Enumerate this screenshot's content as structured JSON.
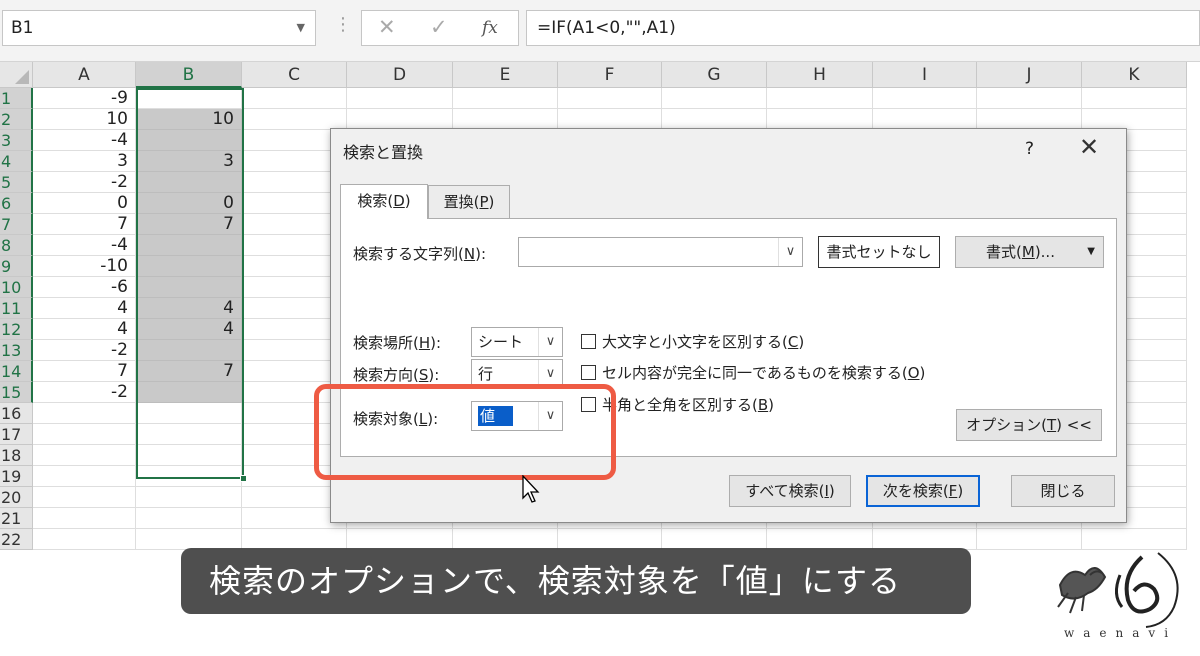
{
  "formula_bar": {
    "name_box": "B1",
    "cancel_icon": "✕",
    "enter_icon": "✓",
    "fx_label": "fx",
    "formula": "=IF(A1<0,\"\",A1)"
  },
  "grid": {
    "columns": [
      "A",
      "B",
      "C",
      "D",
      "E",
      "F",
      "G",
      "H",
      "I",
      "J",
      "K"
    ],
    "rows": [
      "1",
      "2",
      "3",
      "4",
      "5",
      "6",
      "7",
      "8",
      "9",
      "10",
      "11",
      "12",
      "13",
      "14",
      "15",
      "16",
      "17",
      "18",
      "19",
      "20",
      "21",
      "22"
    ],
    "column_a": [
      "-9",
      "10",
      "-4",
      "3",
      "-2",
      "0",
      "7",
      "-4",
      "-10",
      "-6",
      "4",
      "4",
      "-2",
      "7",
      "-2"
    ],
    "column_b": [
      "",
      "10",
      "",
      "3",
      "",
      "0",
      "7",
      "",
      "",
      "",
      "4",
      "4",
      "",
      "7",
      ""
    ],
    "selected_column": "B"
  },
  "dialog": {
    "title": "検索と置換",
    "help": "?",
    "close": "✕",
    "tabs": {
      "find_pre": "検索(",
      "find_key": "D",
      "find_post": ")",
      "replace_pre": "置換(",
      "replace_key": "P",
      "replace_post": ")"
    },
    "find_what_pre": "検索する文字列(",
    "find_what_key": "N",
    "find_what_post": "):",
    "find_what_value": "",
    "no_format_set": "書式セットなし",
    "format_pre": "書式(",
    "format_key": "M",
    "format_post": ")...",
    "within_pre": "検索場所(",
    "within_key": "H",
    "within_post": "):",
    "within_value": "シート",
    "search_pre": "検索方向(",
    "search_key": "S",
    "search_post": "):",
    "search_value": "行",
    "look_in_pre": "検索対象(",
    "look_in_key": "L",
    "look_in_post": "):",
    "look_in_value": "値",
    "match_case_pre": "大文字と小文字を区別する(",
    "match_case_key": "C",
    "match_case_post": ")",
    "match_entire_pre": "セル内容が完全に同一であるものを検索する(",
    "match_entire_key": "O",
    "match_entire_post": ")",
    "match_width_pre": "半角と全角を区別する(",
    "match_width_key": "B",
    "match_width_post": ")",
    "options_pre": "オプション(",
    "options_key": "T",
    "options_post": ") <<",
    "find_all_pre": "すべて検索(",
    "find_all_key": "I",
    "find_all_post": ")",
    "find_next_pre": "次を検索(",
    "find_next_key": "F",
    "find_next_post": ")",
    "close_button": "閉じる"
  },
  "caption": "検索のオプションで、検索対象を「値」にする",
  "logo_text": "waenavi",
  "colors": {
    "excel_green": "#217346",
    "highlight_red": "#ee5b44",
    "selection_blue": "#0a5ec9"
  }
}
